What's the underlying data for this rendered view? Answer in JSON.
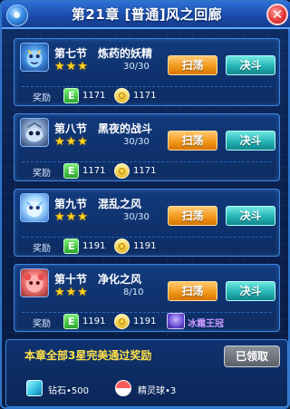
{
  "header": {
    "title": "第21章 [普通]风之回廊",
    "close_label": "✕"
  },
  "common": {
    "sweep_label": "扫荡",
    "battle_label": "决斗",
    "reward_label": "奖励",
    "stars": "★★★"
  },
  "sections": [
    {
      "number": "第七节",
      "name": "炼药的妖精",
      "progress": "30/30",
      "exp": "1171",
      "coins": "1171"
    },
    {
      "number": "第八节",
      "name": "黑夜的战斗",
      "progress": "30/30",
      "exp": "1171",
      "coins": "1171"
    },
    {
      "number": "第九节",
      "name": "混乱之风",
      "progress": "30/30",
      "exp": "1191",
      "coins": "1191"
    },
    {
      "number": "第十节",
      "name": "净化之风",
      "progress": "8/10",
      "exp": "1191",
      "coins": "1191",
      "extra_reward": "冰霜王冠"
    }
  ],
  "chapter_reward": {
    "title": "本章全部3星完美通过奖励",
    "claim_label": "已领取",
    "items": [
      {
        "label": "钻石•500",
        "icon": "gem-icon"
      },
      {
        "label": "精灵球•3",
        "icon": "pokeball-icon"
      }
    ]
  },
  "colors": {
    "sweep_button": "#f39a1c",
    "battle_button": "#24b5b6",
    "stars": "#ffd21e",
    "chapter_reward_title": "#ffe24a",
    "extra_reward_text": "#c99bff"
  }
}
